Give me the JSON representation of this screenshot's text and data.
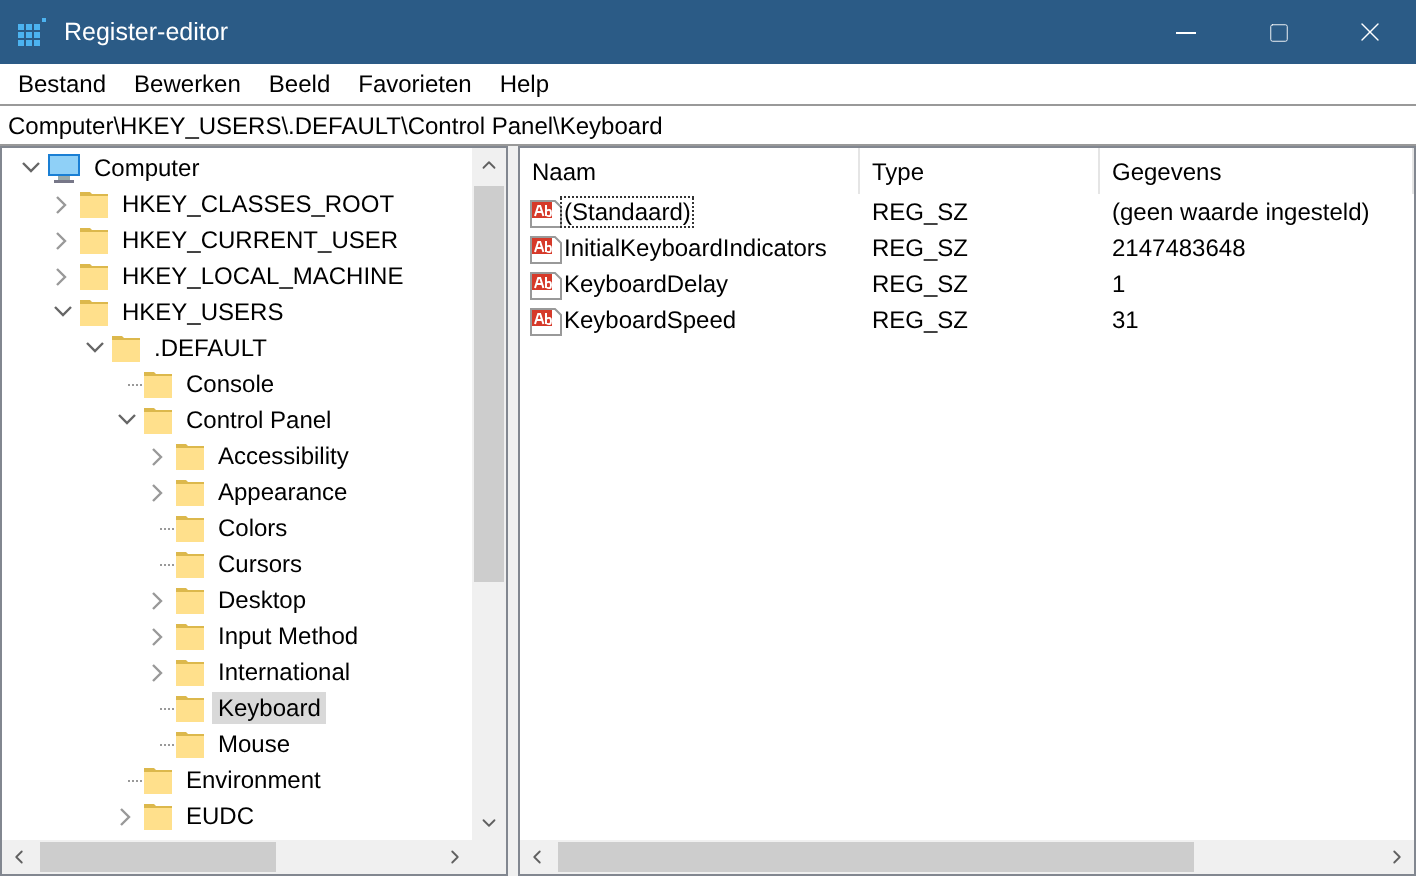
{
  "window": {
    "title": "Register-editor"
  },
  "menu": [
    "Bestand",
    "Bewerken",
    "Beeld",
    "Favorieten",
    "Help"
  ],
  "address": "Computer\\HKEY_USERS\\.DEFAULT\\Control Panel\\Keyboard",
  "tree": [
    {
      "label": "Computer",
      "kind": "computer",
      "expandable": true,
      "expanded": true,
      "selected": false,
      "children": [
        {
          "label": "HKEY_CLASSES_ROOT",
          "kind": "folder",
          "expandable": true,
          "expanded": false,
          "selected": false
        },
        {
          "label": "HKEY_CURRENT_USER",
          "kind": "folder",
          "expandable": true,
          "expanded": false,
          "selected": false
        },
        {
          "label": "HKEY_LOCAL_MACHINE",
          "kind": "folder",
          "expandable": true,
          "expanded": false,
          "selected": false
        },
        {
          "label": "HKEY_USERS",
          "kind": "folder",
          "expandable": true,
          "expanded": true,
          "selected": false,
          "children": [
            {
              "label": ".DEFAULT",
              "kind": "folder",
              "expandable": true,
              "expanded": true,
              "selected": false,
              "children": [
                {
                  "label": "Console",
                  "kind": "folder",
                  "expandable": false,
                  "selected": false
                },
                {
                  "label": "Control Panel",
                  "kind": "folder",
                  "expandable": true,
                  "expanded": true,
                  "selected": false,
                  "children": [
                    {
                      "label": "Accessibility",
                      "kind": "folder",
                      "expandable": true,
                      "expanded": false,
                      "selected": false
                    },
                    {
                      "label": "Appearance",
                      "kind": "folder",
                      "expandable": true,
                      "expanded": false,
                      "selected": false
                    },
                    {
                      "label": "Colors",
                      "kind": "folder",
                      "expandable": false,
                      "selected": false
                    },
                    {
                      "label": "Cursors",
                      "kind": "folder",
                      "expandable": false,
                      "selected": false
                    },
                    {
                      "label": "Desktop",
                      "kind": "folder",
                      "expandable": true,
                      "expanded": false,
                      "selected": false
                    },
                    {
                      "label": "Input Method",
                      "kind": "folder",
                      "expandable": true,
                      "expanded": false,
                      "selected": false
                    },
                    {
                      "label": "International",
                      "kind": "folder",
                      "expandable": true,
                      "expanded": false,
                      "selected": false
                    },
                    {
                      "label": "Keyboard",
                      "kind": "folder",
                      "expandable": false,
                      "selected": true
                    },
                    {
                      "label": "Mouse",
                      "kind": "folder",
                      "expandable": false,
                      "selected": false
                    }
                  ]
                },
                {
                  "label": "Environment",
                  "kind": "folder",
                  "expandable": false,
                  "selected": false
                },
                {
                  "label": "EUDC",
                  "kind": "folder",
                  "expandable": true,
                  "expanded": false,
                  "selected": false
                }
              ]
            }
          ]
        }
      ]
    }
  ],
  "columns": [
    "Naam",
    "Type",
    "Gegevens"
  ],
  "values": [
    {
      "name": "(Standaard)",
      "type": "REG_SZ",
      "data": "(geen waarde ingesteld)",
      "focused": true
    },
    {
      "name": "InitialKeyboardIndicators",
      "type": "REG_SZ",
      "data": "2147483648",
      "focused": false
    },
    {
      "name": "KeyboardDelay",
      "type": "REG_SZ",
      "data": "1",
      "focused": false
    },
    {
      "name": "KeyboardSpeed",
      "type": "REG_SZ",
      "data": "31",
      "focused": false
    }
  ]
}
